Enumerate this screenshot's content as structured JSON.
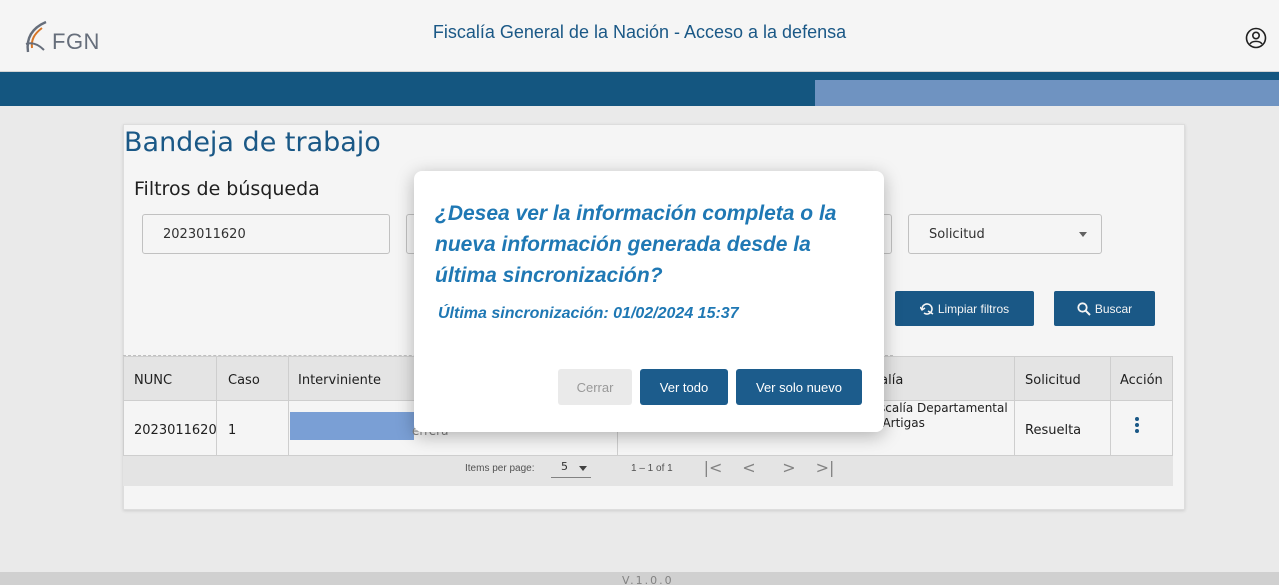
{
  "header": {
    "logo_text": "FGN",
    "app_title": "Fiscalía General de la Nación - Acceso a la defensa",
    "user_icon": "user-circle-icon"
  },
  "main": {
    "page_title": "Bandeja de trabajo",
    "filters_title": "Filtros de búsqueda",
    "nunc_filter_value": "2023011620",
    "solicitud_filter_value": "Solicitud",
    "clear_button": "Limpiar filtros",
    "search_button": "Buscar"
  },
  "table": {
    "headers": [
      "NUNC",
      "Caso",
      "Interviniente",
      "Fiscalía",
      "Solicitud",
      "Acción"
    ],
    "headers_visible": {
      "fiscalia": "calía"
    },
    "rows": [
      {
        "nunc": "2023011620",
        "caso": "1",
        "interviniente_partial": "errera",
        "fiscalia_partial": ", Fiscalía Departamental De Artigas",
        "solicitud": "Resuelta"
      }
    ]
  },
  "paginator": {
    "items_per_page_label": "Items per page:",
    "page_size": "5",
    "range": "1 – 1 of 1",
    "first": "|<",
    "prev": "<",
    "next": ">",
    "last": ">|"
  },
  "footer": {
    "version": "V.1.0.0"
  },
  "dialog": {
    "question": "¿Desea ver la información completa o la nueva información generada desde la última sincronización?",
    "last_sync": "Última sincronización: 01/02/2024 15:37",
    "close_button": "Cerrar",
    "view_all_button": "Ver todo",
    "view_new_button": "Ver solo nuevo"
  },
  "colors": {
    "primary": "#1c5c8c",
    "dialog_text": "#1f78b4",
    "bluebar": "#155a86",
    "mask": "#7fa6de"
  }
}
